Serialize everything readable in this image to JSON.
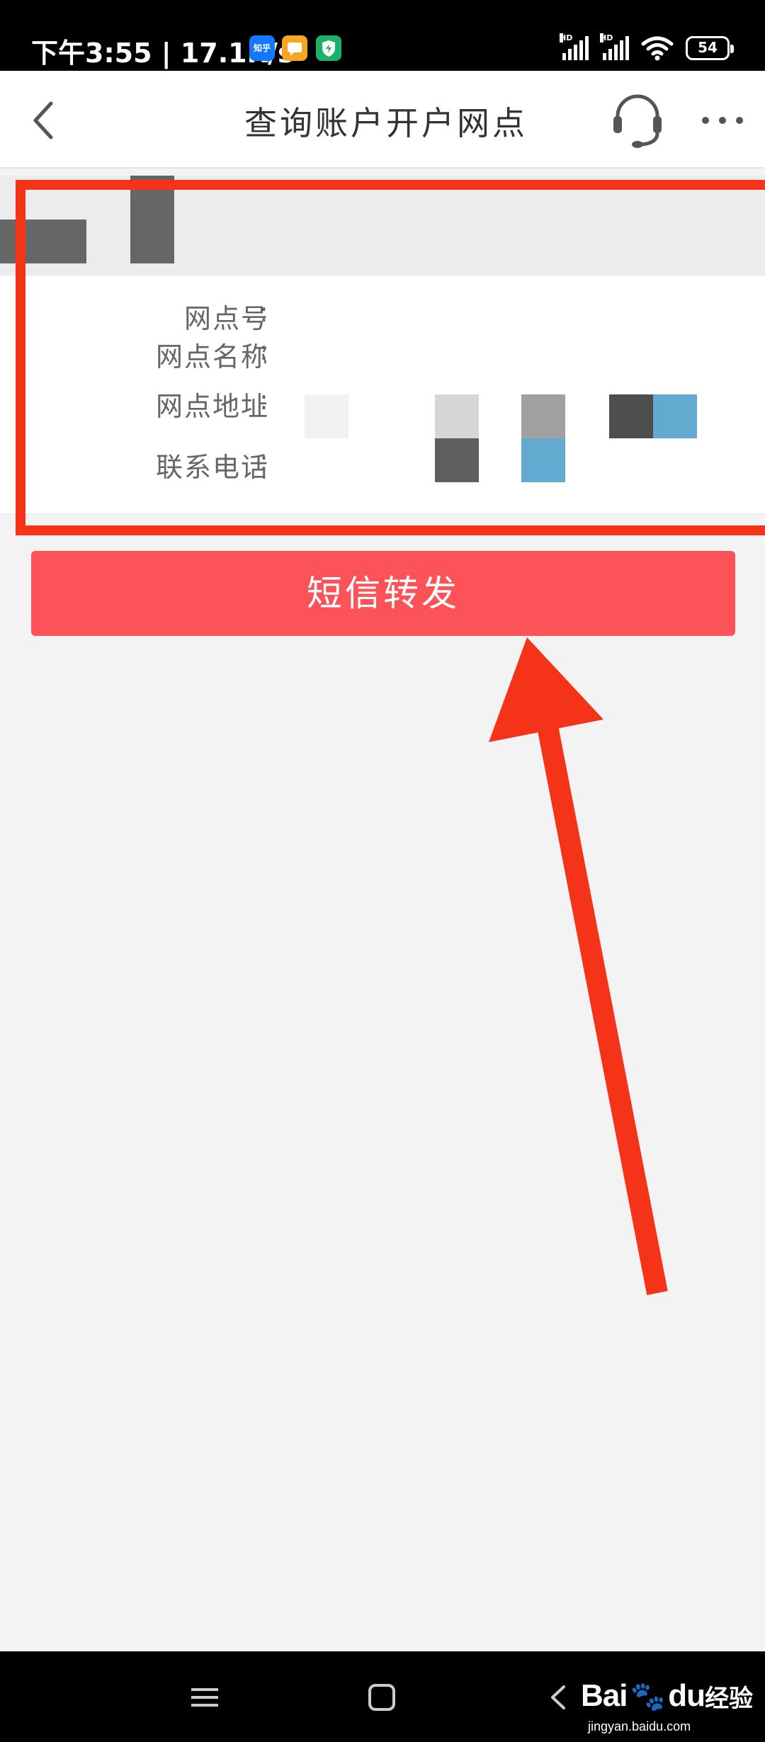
{
  "status_bar": {
    "time_and_speed": "下午3:55 | 17.1K/s",
    "app_badges": [
      {
        "name": "zhihu-app-icon",
        "text": "知乎",
        "color": "#1677ff"
      },
      {
        "name": "message-app-icon",
        "text": "",
        "color": "#f5a623"
      },
      {
        "name": "security-app-icon",
        "text": "",
        "color": "#19b26b"
      }
    ],
    "signal_label": "HD",
    "battery": "54"
  },
  "header": {
    "title": "查询账户开户网点",
    "back_icon": "chevron-left-icon",
    "service_icon": "headset-icon",
    "more_icon": "more-dots-icon"
  },
  "branch_info": {
    "number_label": "网点号",
    "name_label": "网点名称",
    "address_label": "网点地址",
    "phone_label": "联系电话",
    "colon": ":"
  },
  "actions": {
    "sms_forward_label": "短信转发"
  },
  "colors": {
    "accent_button": "#fc5358",
    "annotation_red": "#f43318",
    "page_background": "#f4f3f4"
  },
  "watermark": {
    "logo": "Bai",
    "logo_suffix": "du",
    "brand_cn": "经验",
    "url": "jingyan.baidu.com"
  }
}
